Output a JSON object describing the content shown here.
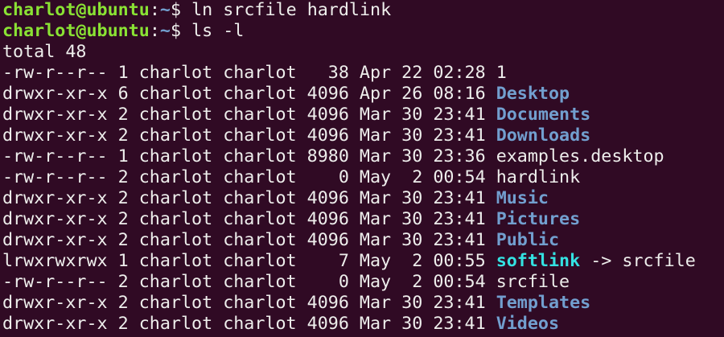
{
  "colors": {
    "background": "#300a24",
    "prompt_user": "#8ae234",
    "prompt_path": "#729fcf",
    "directory": "#729fcf",
    "symlink": "#34e2e2",
    "text": "#eeeeec"
  },
  "commands": [
    {
      "user_host": "charlot@ubuntu",
      "sep": ":",
      "path": "~",
      "symbol": "$ ",
      "command": "ln srcfile hardlink"
    },
    {
      "user_host": "charlot@ubuntu",
      "sep": ":",
      "path": "~",
      "symbol": "$ ",
      "command": "ls -l"
    }
  ],
  "total": "total 48",
  "listing": [
    {
      "meta": "-rw-r--r-- 1 charlot charlot   38 Apr 22 02:28 ",
      "name": "1",
      "kind": "file"
    },
    {
      "meta": "drwxr-xr-x 6 charlot charlot 4096 Apr 26 08:16 ",
      "name": "Desktop",
      "kind": "dir"
    },
    {
      "meta": "drwxr-xr-x 2 charlot charlot 4096 Mar 30 23:41 ",
      "name": "Documents",
      "kind": "dir"
    },
    {
      "meta": "drwxr-xr-x 2 charlot charlot 4096 Mar 30 23:41 ",
      "name": "Downloads",
      "kind": "dir"
    },
    {
      "meta": "-rw-r--r-- 1 charlot charlot 8980 Mar 30 23:36 ",
      "name": "examples.desktop",
      "kind": "file"
    },
    {
      "meta": "-rw-r--r-- 2 charlot charlot    0 May  2 00:54 ",
      "name": "hardlink",
      "kind": "file"
    },
    {
      "meta": "drwxr-xr-x 2 charlot charlot 4096 Mar 30 23:41 ",
      "name": "Music",
      "kind": "dir"
    },
    {
      "meta": "drwxr-xr-x 2 charlot charlot 4096 Mar 30 23:41 ",
      "name": "Pictures",
      "kind": "dir"
    },
    {
      "meta": "drwxr-xr-x 2 charlot charlot 4096 Mar 30 23:41 ",
      "name": "Public",
      "kind": "dir"
    },
    {
      "meta": "lrwxrwxrwx 1 charlot charlot    7 May  2 00:55 ",
      "name": "softlink",
      "kind": "link",
      "target": " -> srcfile"
    },
    {
      "meta": "-rw-r--r-- 2 charlot charlot    0 May  2 00:54 ",
      "name": "srcfile",
      "kind": "file"
    },
    {
      "meta": "drwxr-xr-x 2 charlot charlot 4096 Mar 30 23:41 ",
      "name": "Templates",
      "kind": "dir"
    },
    {
      "meta": "drwxr-xr-x 2 charlot charlot 4096 Mar 30 23:41 ",
      "name": "Videos",
      "kind": "dir"
    }
  ]
}
